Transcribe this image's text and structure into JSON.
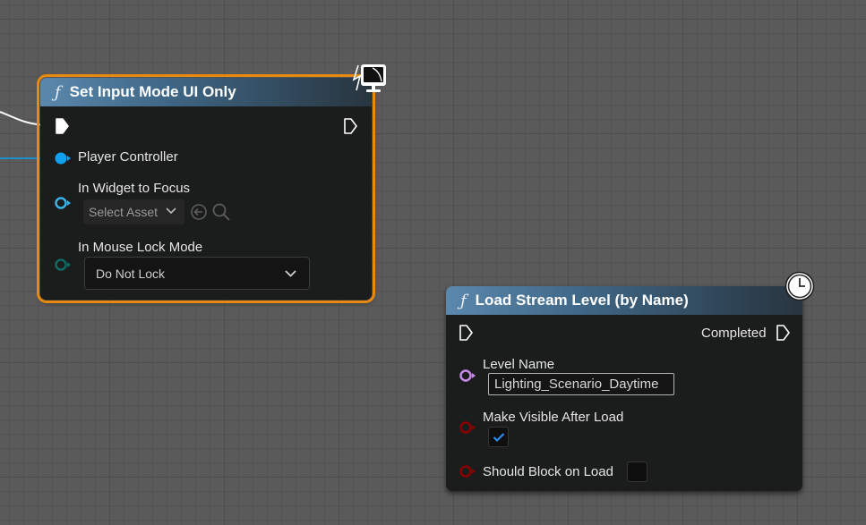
{
  "nodes": {
    "set_input_mode": {
      "title": "Set Input Mode UI Only",
      "function_icon": "ƒ",
      "badge_icon": "monitor-icon",
      "pins": {
        "player_controller": "Player Controller",
        "widget_to_focus": "In Widget to Focus",
        "widget_to_focus_value": "Select Asset",
        "mouse_lock_mode": "In Mouse Lock Mode",
        "mouse_lock_value": "Do Not Lock"
      }
    },
    "load_stream_level": {
      "title": "Load Stream Level (by Name)",
      "function_icon": "ƒ",
      "badge_icon": "clock-icon",
      "pins": {
        "completed": "Completed",
        "level_name": "Level Name",
        "level_name_value": "Lighting_Scenario_Daytime",
        "make_visible": "Make Visible After Load",
        "make_visible_checked": true,
        "should_block": "Should Block on Load",
        "should_block_checked": false
      }
    }
  },
  "colors": {
    "selection_outline": "#e88a10",
    "object_pin": "#10a0f0",
    "widget_pin": "#3ab2e8",
    "enum_pin": "#0f6a64",
    "name_pin": "#c88ae6",
    "bool_pin": "#8c0000",
    "exec_wire": "#ffffff",
    "object_wire": "#10a0f0"
  }
}
